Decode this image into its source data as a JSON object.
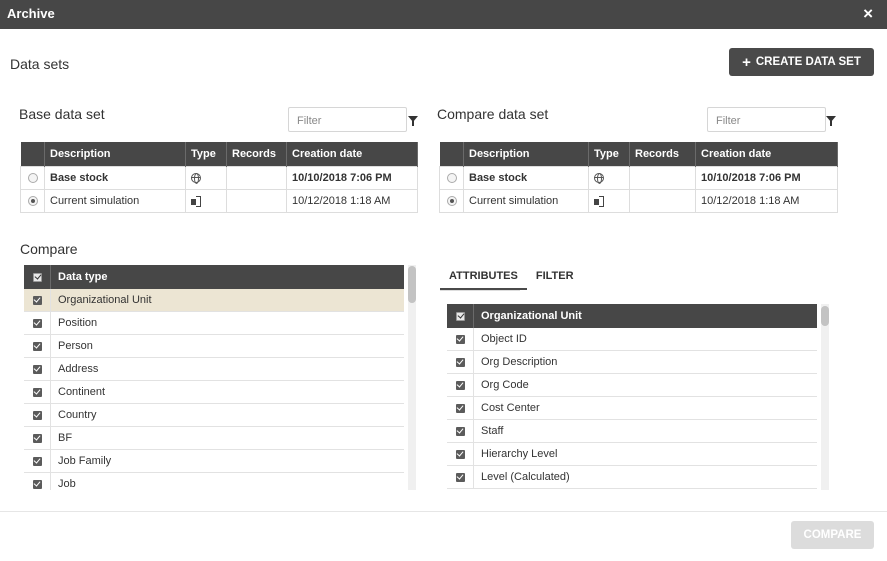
{
  "window": {
    "title": "Archive",
    "close_glyph": "×"
  },
  "datasets": {
    "heading": "Data sets",
    "create_button": {
      "icon": "plus-icon",
      "label": "CREATE DATA SET"
    }
  },
  "base": {
    "heading": "Base data set",
    "filter_placeholder": "Filter",
    "columns": [
      "Description",
      "Type",
      "Records",
      "Creation date"
    ],
    "rows": [
      {
        "selected": false,
        "description": "Base stock",
        "type_icon": "globe-icon",
        "records": "",
        "date": "10/10/2018 7:06 PM",
        "bold": true
      },
      {
        "selected": true,
        "description": "Current simulation",
        "type_icon": "simulation-icon",
        "records": "",
        "date": "10/12/2018 1:18 AM",
        "bold": false
      }
    ]
  },
  "compare_set": {
    "heading": "Compare data set",
    "filter_placeholder": "Filter",
    "columns": [
      "Description",
      "Type",
      "Records",
      "Creation date"
    ],
    "rows": [
      {
        "selected": false,
        "description": "Base stock",
        "type_icon": "globe-icon",
        "records": "",
        "date": "10/10/2018 7:06 PM",
        "bold": true
      },
      {
        "selected": true,
        "description": "Current simulation",
        "type_icon": "simulation-icon",
        "records": "",
        "date": "10/12/2018 1:18 AM",
        "bold": false
      }
    ]
  },
  "compare": {
    "heading": "Compare",
    "header": "Data type",
    "items": [
      "Organizational Unit",
      "Position",
      "Person",
      "Address",
      "Continent",
      "Country",
      "BF",
      "Job Family",
      "Job"
    ],
    "selected_index": 0
  },
  "attributes": {
    "tabs": [
      "ATTRIBUTES",
      "FILTER"
    ],
    "active_tab": "ATTRIBUTES",
    "header": "Organizational Unit",
    "items": [
      "Object ID",
      "Org Description",
      "Org Code",
      "Cost Center",
      "Staff",
      "Hierarchy Level",
      "Level (Calculated)"
    ]
  },
  "footer": {
    "compare_button": "COMPARE"
  },
  "colors": {
    "header_bg": "#474747",
    "selected_row": "#ece5d3",
    "disabled_button": "#dcdcdc"
  }
}
